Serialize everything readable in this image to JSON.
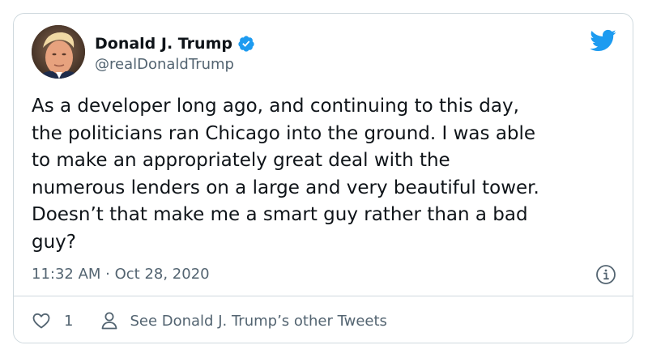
{
  "tweet": {
    "display_name": "Donald J. Trump",
    "handle": "@realDonaldTrump",
    "text": "As a developer long ago, and continuing to this day,\nthe politicians ran Chicago into the ground. I was able\nto make an appropriately great deal with the\nnumerous lenders on a large and very beautiful tower.\nDoesn’t that make me a smart guy rather than a bad\nguy?",
    "time": "11:32 AM",
    "date": "Oct 28, 2020",
    "timestamp": "11:32 AM · Oct 28, 2020",
    "likes": "1",
    "other_tweets_label": "See Donald J. Trump’s other Tweets"
  },
  "icons": {
    "verified": "verified-badge-icon",
    "bird": "twitter-bird-icon",
    "info": "info-icon",
    "heart": "heart-icon",
    "person": "person-icon"
  },
  "colors": {
    "twitter_blue": "#1d9bf0",
    "text_primary": "#0f1419",
    "text_secondary": "#536471",
    "border": "#cfd9de"
  }
}
